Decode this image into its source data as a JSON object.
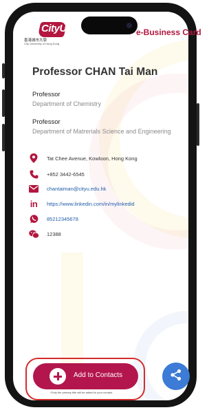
{
  "header": {
    "logo_text": "CityU",
    "logo_zh": "香港城市大學",
    "logo_en": "City University of Hong Kong",
    "title": "e-Business Card"
  },
  "profile": {
    "name": "Professor CHAN Tai Man",
    "positions": [
      {
        "title": "Professor",
        "department": "Department of Chemistry"
      },
      {
        "title": "Professor",
        "department": "Department of Matrerials Science and Engineering"
      }
    ]
  },
  "contacts": {
    "address": "Tat Chee Avenue, Kowloon, Hong Kong",
    "phone": "+852 3442-6545",
    "email": "chantaiman@cityu.edu.hk",
    "linkedin": "https://www.linkedin.com/in/mylinkedid",
    "whatsapp": "85212345678",
    "wechat": "12388"
  },
  "actions": {
    "add_to_contacts": "Add to Contacts",
    "note": "*Only the primary title will be added to your contact."
  },
  "colors": {
    "brand": "#b3163f",
    "link": "#1f5ba8",
    "share": "#3c7bd6",
    "highlight": "#d42b2b"
  },
  "icons": [
    "location-icon",
    "phone-icon",
    "email-icon",
    "linkedin-icon",
    "whatsapp-icon",
    "wechat-icon",
    "plus-icon",
    "share-icon"
  ]
}
